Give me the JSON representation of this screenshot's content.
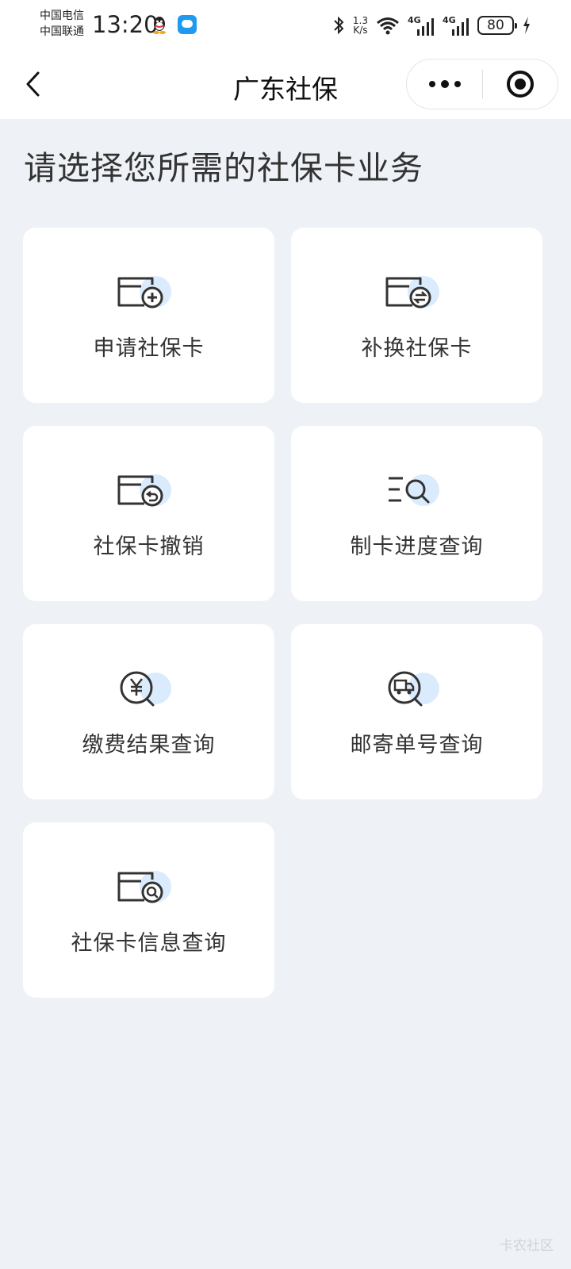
{
  "status_bar": {
    "carrier_1": "中国电信",
    "carrier_2": "中国联通",
    "time": "13:20",
    "net_speed_value": "1.3",
    "net_speed_unit": "K/s",
    "sim1_net": "4G",
    "sim2_net": "4G",
    "battery": "80",
    "icons": [
      "qq-icon",
      "message-icon",
      "bluetooth-icon",
      "wifi-icon",
      "signal-icon",
      "battery-icon",
      "charging-icon"
    ]
  },
  "title_bar": {
    "title": "广东社保",
    "icons": [
      "back-icon",
      "more-icon",
      "close-target-icon"
    ]
  },
  "main": {
    "heading": "请选择您所需的社保卡业务",
    "services": [
      {
        "label": "申请社保卡",
        "icon": "card-add-icon"
      },
      {
        "label": "补换社保卡",
        "icon": "card-swap-icon"
      },
      {
        "label": "社保卡撤销",
        "icon": "card-revoke-icon"
      },
      {
        "label": "制卡进度查询",
        "icon": "list-search-icon"
      },
      {
        "label": "缴费结果查询",
        "icon": "yuan-search-icon"
      },
      {
        "label": "邮寄单号查询",
        "icon": "truck-search-icon"
      },
      {
        "label": "社保卡信息查询",
        "icon": "card-search-icon"
      }
    ]
  },
  "watermark": "卡农社区",
  "colors": {
    "background": "#eef1f6",
    "card": "#ffffff",
    "icon_accent": "#d9ebfd",
    "icon_stroke": "#333333"
  }
}
